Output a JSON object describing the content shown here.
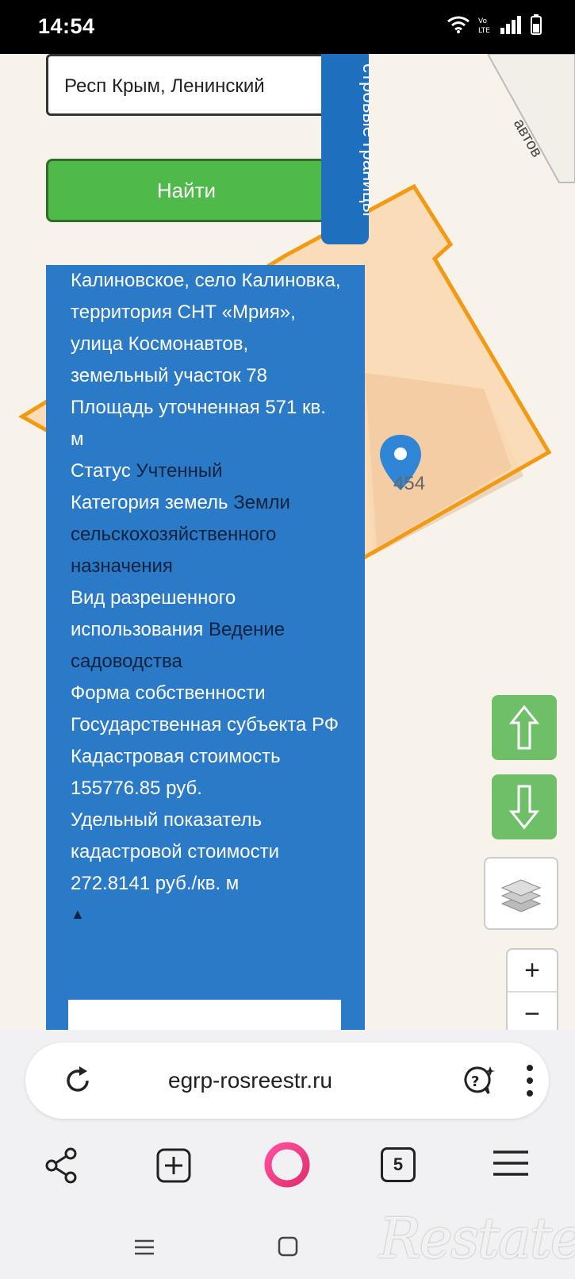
{
  "status_bar": {
    "time": "14:54",
    "icons": [
      "wifi-icon",
      "volte-icon",
      "signal-icon",
      "battery-icon"
    ]
  },
  "map": {
    "search_value": "Респ Крым, Ленинский",
    "find_label": "Найти",
    "cadastral_tab_label": "стровые границы",
    "street_label": "автов",
    "parcel_number": "454",
    "colors": {
      "parcel_fill": "#fbd9b3",
      "parcel_border": "#f39a14",
      "panel_bg": "#2b7ac8",
      "button_green": "#4fb94a",
      "nav_green": "#6fbf69"
    }
  },
  "info": {
    "address_text": "Калиновское, село Калиновка, территория СНТ «Мрия», улица Космонавтов, земельный участок 78",
    "area_label": "Площадь уточненная",
    "area_value": "571 кв. м",
    "status_label": "Статус",
    "status_value": "Учтенный",
    "category_label": "Категория земель",
    "category_value": "Земли сельскохозяйственного назначения",
    "use_label": "Вид разрешенного использования",
    "use_value": "Ведение садоводства",
    "ownership_label": "Форма собственности",
    "ownership_value": "Государственная субъекта РФ",
    "cost_label": "Кадастровая стоимость",
    "cost_value": "155776.85 руб.",
    "specific_label": "Удельный показатель кадастровой стоимости",
    "specific_value": "272.8141 руб./кв. м",
    "collapse_symbol": "▲"
  },
  "controls": {
    "zoom_in": "+",
    "zoom_out": "−"
  },
  "browser": {
    "url": "egrp-rosreestr.ru",
    "tab_count": "5"
  },
  "watermark": "Restate"
}
